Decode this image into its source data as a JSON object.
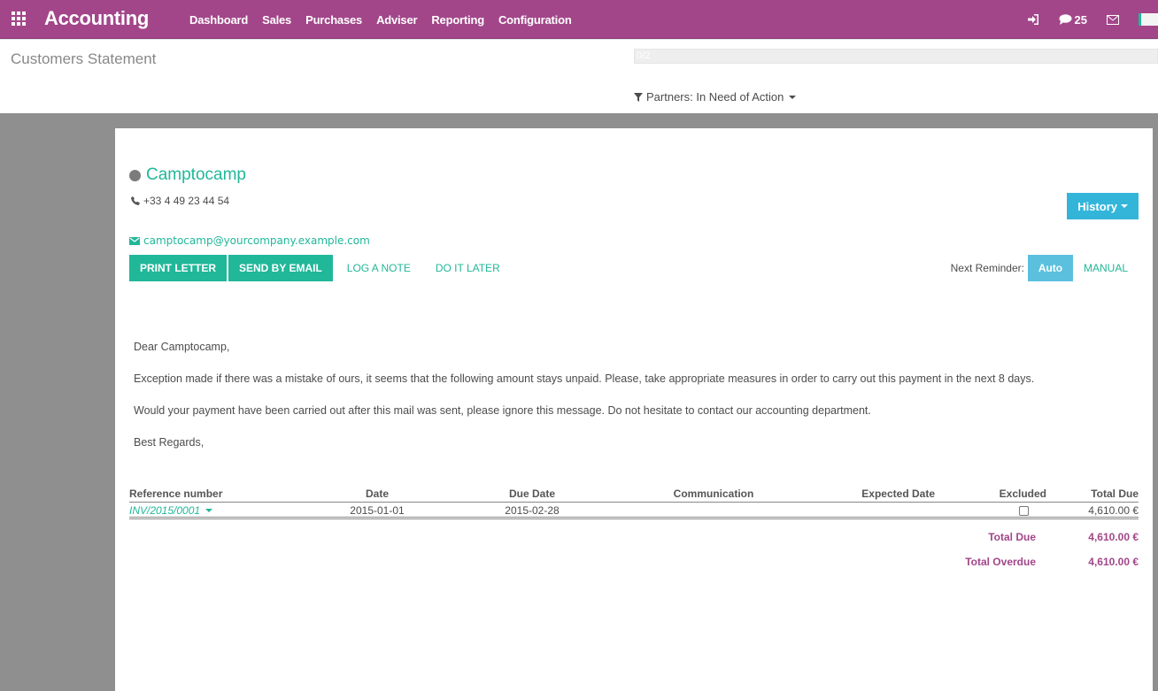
{
  "navbar": {
    "app_title": "Accounting",
    "menu": [
      "Dashboard",
      "Sales",
      "Purchases",
      "Adviser",
      "Reporting",
      "Configuration"
    ],
    "icons": {
      "apps": "apps-grid-icon",
      "login": "sign-in-icon",
      "chat": "chat-bubble-icon",
      "mail": "envelope-icon"
    },
    "message_count": "25",
    "brand_color": "#a24689"
  },
  "control_panel": {
    "breadcrumb": "Customers Statement",
    "progress": {
      "label": "0/2",
      "done": 0,
      "total": 2
    },
    "filter_label": "Partners: In Need of Action"
  },
  "partner": {
    "name": "Camptocamp",
    "phone": "+33 4 49 23 44 54",
    "email": "camptocamp@yourcompany.example.com"
  },
  "actions": {
    "print_letter": "PRINT LETTER",
    "send_by_email": "SEND BY EMAIL",
    "log_a_note": "LOG A NOTE",
    "do_it_later": "DO IT LATER",
    "history": "History",
    "next_reminder_label": "Next Reminder:",
    "auto": "Auto",
    "manual": "MANUAL"
  },
  "letter": {
    "greeting": "Dear Camptocamp,",
    "paragraph1": "Exception made if there was a mistake of ours, it seems that the following amount stays unpaid. Please, take appropriate measures in order to carry out this payment in the next 8 days.",
    "paragraph2": "Would your payment have been carried out after this mail was sent, please ignore this message. Do not hesitate to contact our accounting department.",
    "closing": "Best Regards,"
  },
  "table": {
    "headers": [
      "Reference number",
      "Date",
      "Due Date",
      "Communication",
      "Expected Date",
      "Excluded",
      "Total Due"
    ],
    "rows": [
      {
        "reference": "INV/2015/0001",
        "date": "2015-01-01",
        "due_date": "2015-02-28",
        "communication": "",
        "expected_date": "",
        "excluded": false,
        "total_due": "4,610.00 €"
      }
    ],
    "total_due_label": "Total Due",
    "total_due": "4,610.00 €",
    "total_overdue_label": "Total Overdue",
    "total_overdue": "4,610.00 €"
  }
}
